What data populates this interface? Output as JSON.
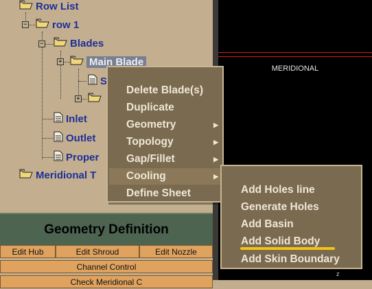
{
  "tree": {
    "row_list": "Row List",
    "row1": "row 1",
    "blades": "Blades",
    "main_blade": "Main Blade",
    "partial_s": "S",
    "inlet": "Inlet",
    "outlet": "Outlet",
    "properties_partial": "Proper",
    "meridional_partial": "Meridional T"
  },
  "viewport": {
    "title": "MERIDIONAL",
    "axis_label": "z"
  },
  "geometry": {
    "header": "Geometry Definition",
    "buttons": [
      "Edit Hub",
      "Edit Shroud",
      "Edit Nozzle"
    ],
    "channel_control": "Channel Control",
    "partial_row": "Check Meridional C"
  },
  "context_menu": {
    "items": [
      {
        "label": "Delete Blade(s)",
        "submenu": false
      },
      {
        "label": "Duplicate",
        "submenu": false
      },
      {
        "label": "Geometry",
        "submenu": true
      },
      {
        "label": "Topology",
        "submenu": true
      },
      {
        "label": "Gap/Fillet",
        "submenu": true
      },
      {
        "label": "Cooling",
        "submenu": true
      },
      {
        "label": "Define Sheet",
        "submenu": false
      }
    ]
  },
  "submenu": {
    "items": [
      "Add Holes line",
      "Generate Holes",
      "Add Basin",
      "Add Solid Body",
      "Add Skin Boundary"
    ]
  },
  "colors": {
    "tree_text": "#1d2f96",
    "menu_bg": "#7a6a50",
    "menu_text": "#efe7d6",
    "highlight_underline": "#f2c414",
    "button_bg": "#e0a35f"
  }
}
